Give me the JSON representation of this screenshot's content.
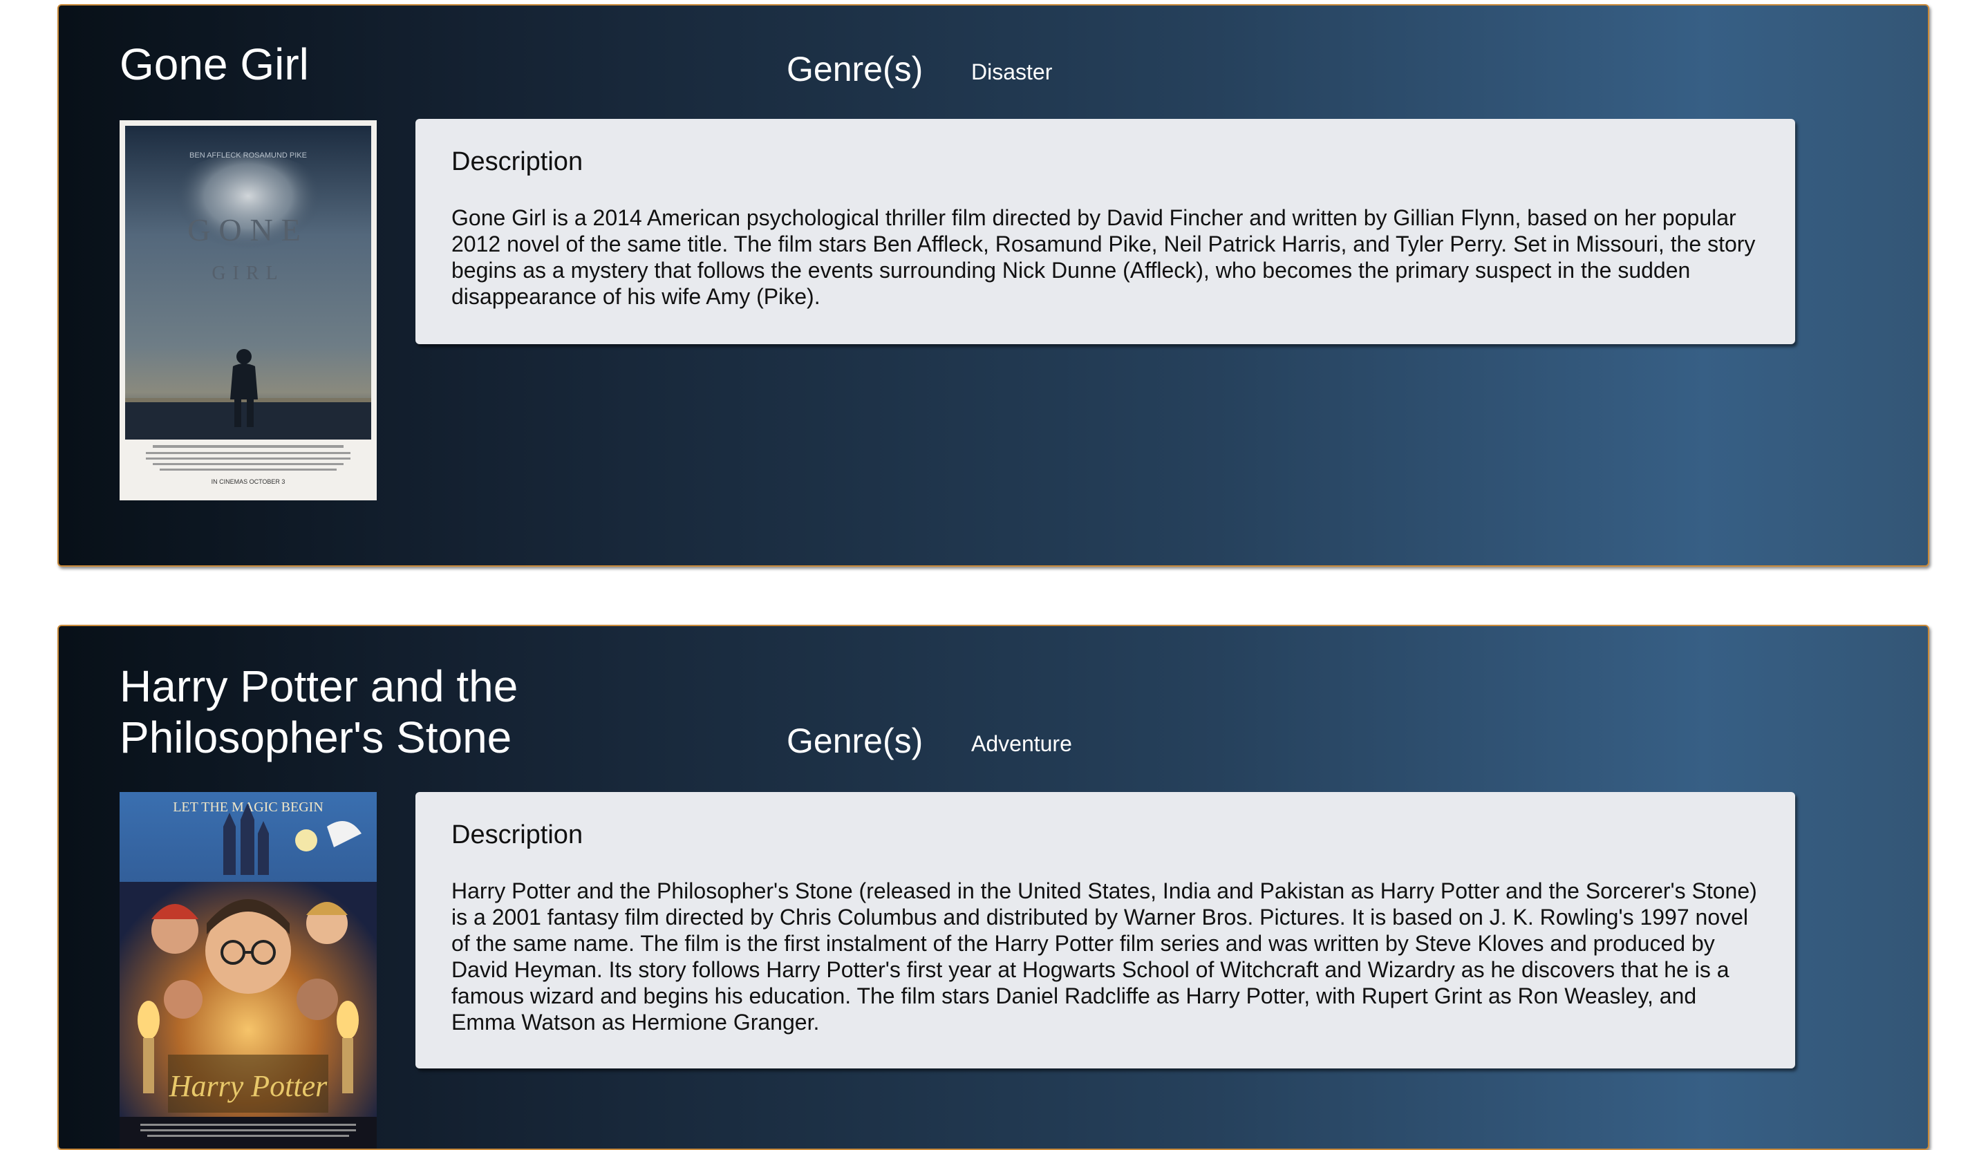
{
  "movies": [
    {
      "title": "Gone Girl",
      "genre_label": "Genre(s)",
      "genre": "Disaster",
      "description_heading": "Description",
      "description": "Gone Girl is a 2014 American psychological thriller film directed by David Fincher and written by Gillian Flynn, based on her popular 2012 novel of the same title. The film stars Ben Affleck, Rosamund Pike, Neil Patrick Harris, and Tyler Perry. Set in Missouri, the story begins as a mystery that follows the events surrounding Nick Dunne (Affleck), who becomes the primary suspect in the sudden disappearance of his wife Amy (Pike).",
      "poster": {
        "top_credits": "BEN AFFLECK   ROSAMUND PIKE",
        "title_line1": "GONE",
        "title_line2": "GIRL",
        "release": "IN CINEMAS OCTOBER 3"
      }
    },
    {
      "title": "Harry Potter and the Philosopher's Stone",
      "genre_label": "Genre(s)",
      "genre": "Adventure",
      "description_heading": "Description",
      "description": "Harry Potter and the Philosopher's Stone (released in the United States, India and Pakistan as Harry Potter and the Sorcerer's Stone) is a 2001 fantasy film directed by Chris Columbus and distributed by Warner Bros. Pictures. It is based on J. K. Rowling's 1997 novel of the same name. The film is the first instalment of the Harry Potter film series and was written by Steve Kloves and produced by David Heyman. Its story follows Harry Potter's first year at Hogwarts School of Witchcraft and Wizardry as he discovers that he is a famous wizard and begins his education. The film stars Daniel Radcliffe as Harry Potter, with Rupert Grint as Ron Weasley, and Emma Watson as Hermione Granger.",
      "poster": {
        "top_text": "LET THE MAGIC BEGIN",
        "logo": "Harry Potter"
      }
    }
  ],
  "colors": {
    "card_border": "#c98a3a",
    "card_gradient_start": "#081018",
    "card_gradient_end": "#375f85",
    "description_bg": "#e8eaee"
  }
}
